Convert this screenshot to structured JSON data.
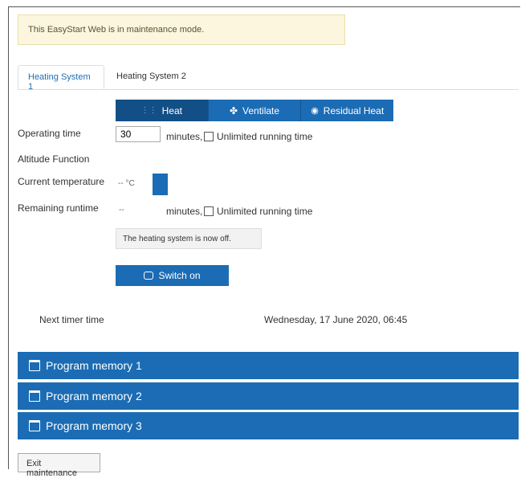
{
  "alert": "This EasyStart Web is in maintenance mode.",
  "tabs": [
    "Heating System 1",
    "Heating System 2"
  ],
  "modes": [
    "Heat",
    "Ventilate",
    "Residual Heat"
  ],
  "operating_time": {
    "label": "Operating time",
    "value": "30",
    "unit": "minutes,",
    "checkbox_label": "Unlimited running time"
  },
  "altitude_label": "Altitude Function",
  "current_temperature": {
    "label": "Current temperature",
    "value": "-- °C"
  },
  "remaining_runtime": {
    "label": "Remaining runtime",
    "value": "--",
    "unit": "minutes,",
    "checkbox_label": "Unlimited running time"
  },
  "status_message": "The heating system is now off.",
  "switch_label": "Switch on",
  "next_timer": {
    "label": "Next timer time",
    "value": "Wednesday, 17 June 2020, 06:45"
  },
  "programs": [
    "Program memory 1",
    "Program memory 2",
    "Program memory 3"
  ],
  "exit_label": "Exit maintenance",
  "colors": {
    "primary": "#1b6cb4",
    "alert_bg": "#fbf6dd"
  }
}
